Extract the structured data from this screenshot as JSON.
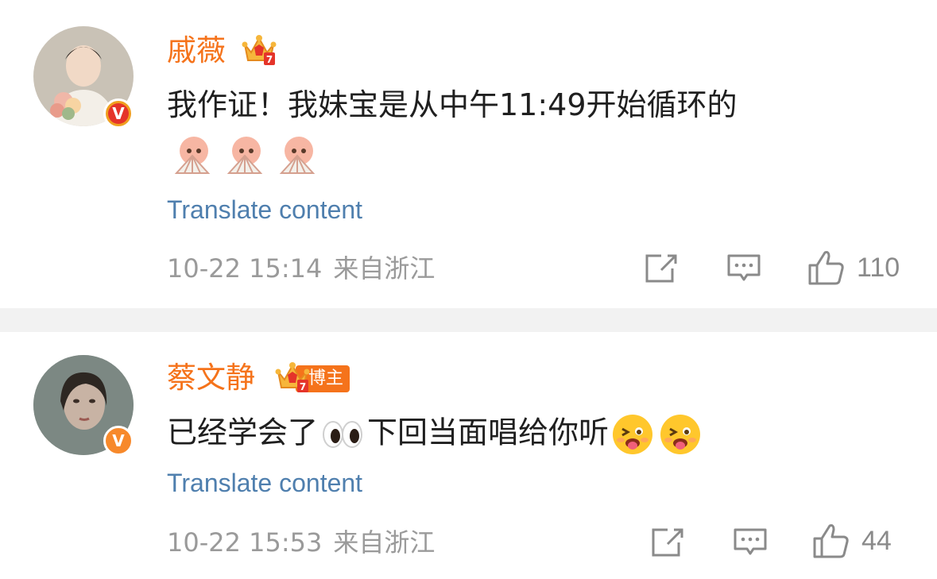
{
  "posts": [
    {
      "username": "戚薇",
      "comment": "我作证！我妹宝是从中午11:49开始循环的",
      "emojis": [
        "fan-girl-emoji",
        "fan-girl-emoji",
        "fan-girl-emoji"
      ],
      "translate_label": "Translate content",
      "date": "10-22 15:14",
      "location": "来自浙江",
      "likes": "110"
    },
    {
      "username": "蔡文静",
      "blogger_tag": "博主",
      "comment_part1": "已经学会了",
      "comment_part2": "下回当面唱给你听",
      "translate_label": "Translate content",
      "date": "10-22 15:53",
      "location": "来自浙江",
      "likes": "44"
    }
  ],
  "colors": {
    "username": "#f5731b",
    "translate_link": "#4f7fae",
    "meta_text": "#9a9a9a",
    "separator": "#f2f2f2"
  }
}
